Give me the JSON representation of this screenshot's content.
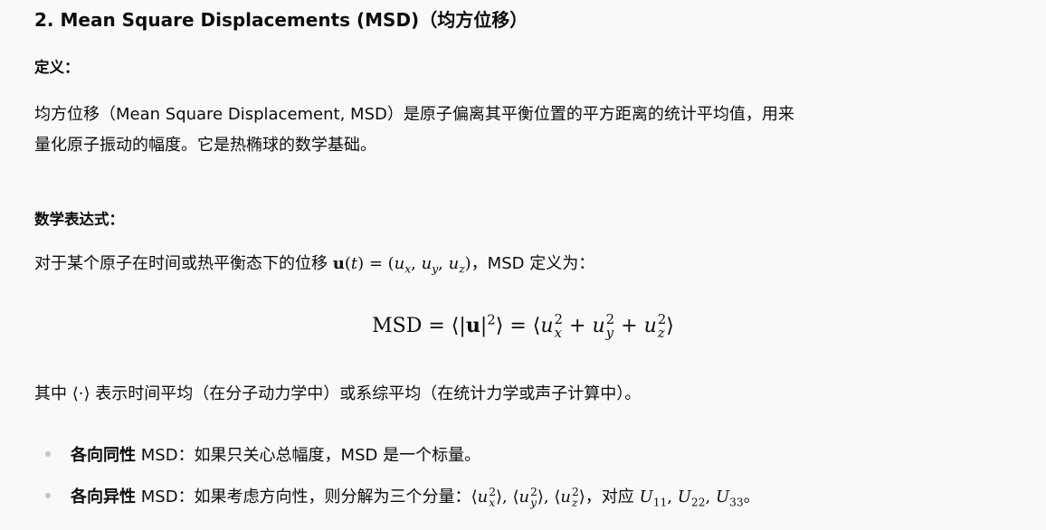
{
  "section": {
    "heading": "2. Mean Square Displacements (MSD)（均方位移）",
    "definition_title": "定义：",
    "definition_line1": "均方位移（Mean Square Displacement, MSD）是原子偏离其平衡位置的平方距离的统计平均值，用来",
    "definition_line2": "量化原子振动的幅度。它是热椭球的数学基础。",
    "math_title": "数学表达式：",
    "math_intro_prefix": "对于某个原子在时间或热平衡态下的位移",
    "math_intro_suffix": "，MSD 定义为：",
    "formula_label": "MSD",
    "average_note_prefix": "其中",
    "average_symbol": "⟨·⟩",
    "average_note_suffix": "表示时间平均（在分子动力学中）或系综平均（在统计力学或声子计算中）。",
    "bullets": [
      {
        "label": "各向同性",
        "suffix": "MSD",
        "text": "：如果只关心总幅度，MSD 是一个标量。"
      },
      {
        "label": "各向异性",
        "suffix": "MSD",
        "text_prefix": "：如果考虑方向性，则分解为三个分量：",
        "text_mid": "，对应",
        "text_end": "。"
      }
    ]
  }
}
